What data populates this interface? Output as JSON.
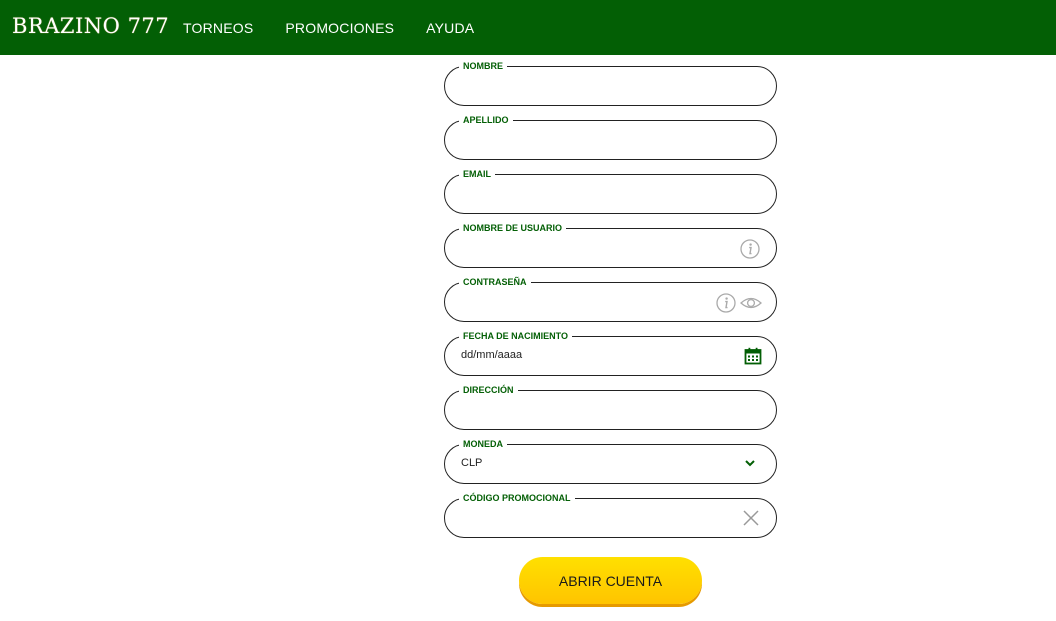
{
  "header": {
    "logo": "BRAZINO 777",
    "nav": [
      "TORNEOS",
      "PROMOCIONES",
      "AYUDA"
    ],
    "bg_color": "#035f05"
  },
  "form": {
    "fields": [
      {
        "label": "NOMBRE",
        "value": ""
      },
      {
        "label": "APELLIDO",
        "value": ""
      },
      {
        "label": "EMAIL",
        "value": ""
      },
      {
        "label": "NOMBRE DE USUARIO",
        "value": "",
        "icons": [
          "info-icon"
        ]
      },
      {
        "label": "CONTRASEÑA",
        "value": "",
        "icons": [
          "info-icon",
          "eye-icon"
        ]
      },
      {
        "label": "FECHA DE NACIMIENTO",
        "value": "dd/mm/aaaa",
        "icons": [
          "calendar-icon"
        ]
      },
      {
        "label": "DIRECCIÓN",
        "value": ""
      },
      {
        "label": "MONEDA",
        "value": "CLP",
        "icons": [
          "chevron-down-icon"
        ]
      },
      {
        "label": "CÓDIGO PROMOCIONAL",
        "value": "",
        "icons": [
          "clear-icon"
        ]
      }
    ],
    "label_color": "#035f05",
    "submit_label": "ABRIR CUENTA",
    "submit_color": "#ffd400"
  }
}
